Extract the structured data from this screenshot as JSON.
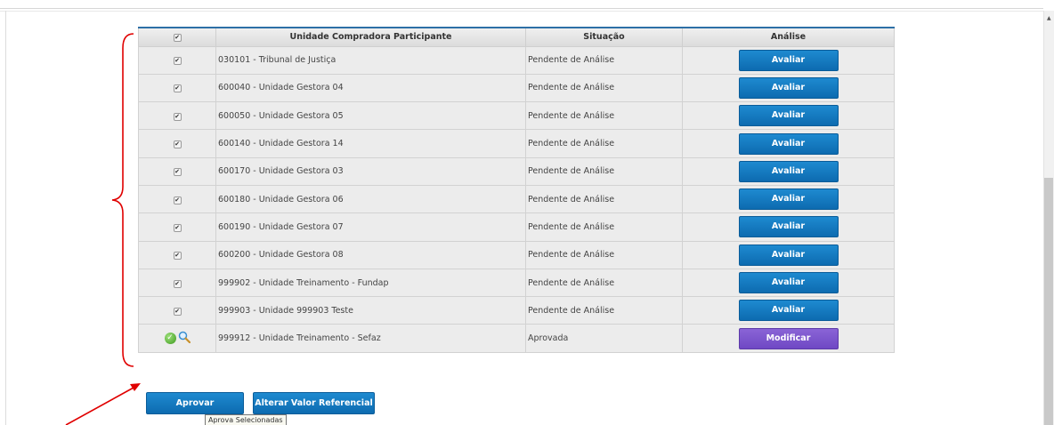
{
  "table": {
    "header": {
      "select_all": "✔",
      "unit": "Unidade Compradora Participante",
      "status": "Situação",
      "analysis": "Análise"
    },
    "rows": [
      {
        "unit": "030101 - Tribunal de Justiça",
        "status": "Pendente de Análise",
        "action": "Avaliar",
        "checked": "✔"
      },
      {
        "unit": "600040 - Unidade Gestora 04",
        "status": "Pendente de Análise",
        "action": "Avaliar",
        "checked": "✔"
      },
      {
        "unit": "600050 - Unidade Gestora 05",
        "status": "Pendente de Análise",
        "action": "Avaliar",
        "checked": "✔"
      },
      {
        "unit": "600140 - Unidade Gestora 14",
        "status": "Pendente de Análise",
        "action": "Avaliar",
        "checked": "✔"
      },
      {
        "unit": "600170 - Unidade Gestora 03",
        "status": "Pendente de Análise",
        "action": "Avaliar",
        "checked": "✔"
      },
      {
        "unit": "600180 - Unidade Gestora 06",
        "status": "Pendente de Análise",
        "action": "Avaliar",
        "checked": "✔"
      },
      {
        "unit": "600190 - Unidade Gestora 07",
        "status": "Pendente de Análise",
        "action": "Avaliar",
        "checked": "✔"
      },
      {
        "unit": "600200 - Unidade Gestora 08",
        "status": "Pendente de Análise",
        "action": "Avaliar",
        "checked": "✔"
      },
      {
        "unit": "999902 - Unidade Treinamento - Fundap",
        "status": "Pendente de Análise",
        "action": "Avaliar",
        "checked": "✔"
      },
      {
        "unit": "999903 - Unidade 999903 Teste",
        "status": "Pendente de Análise",
        "action": "Avaliar",
        "checked": "✔"
      },
      {
        "unit": "999912 - Unidade Treinamento - Sefaz",
        "status": "Aprovada",
        "action": "Modificar",
        "checked": "✔"
      }
    ]
  },
  "footer": {
    "approve_label": "Aprovar",
    "change_ref_label": "Alterar Valor Referencial",
    "tooltip": "Aprova Selecionadas"
  },
  "icons": {
    "approved": "check-circle-icon",
    "view": "magnifier-icon",
    "annotation_arrow": "red-arrow",
    "annotation_brace": "red-brace"
  },
  "colors": {
    "primary_button": "#1479c1",
    "modify_button": "#7b55cf",
    "annotation": "#e00000",
    "header_border": "#2d6fa6"
  }
}
